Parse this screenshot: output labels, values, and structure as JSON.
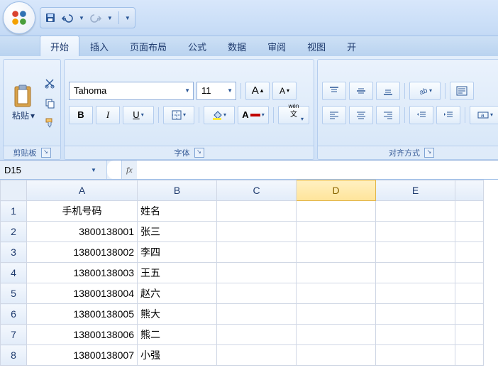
{
  "qat": {
    "save": "save",
    "undo": "undo",
    "redo": "redo"
  },
  "tabs": {
    "items": [
      "开始",
      "插入",
      "页面布局",
      "公式",
      "数据",
      "审阅",
      "视图",
      "开"
    ],
    "active_index": 0
  },
  "ribbon": {
    "clipboard": {
      "paste_label": "粘贴",
      "group_label": "剪贴板"
    },
    "font": {
      "name": "Tahoma",
      "size": "11",
      "increase": "A",
      "decrease": "A",
      "bold": "B",
      "italic": "I",
      "underline": "U",
      "wen": "wén 文",
      "group_label": "字体"
    },
    "align": {
      "group_label": "对齐方式"
    }
  },
  "formula_bar": {
    "cell_ref": "D15",
    "fx_label": "fx",
    "value": ""
  },
  "sheet": {
    "columns": [
      "A",
      "B",
      "C",
      "D",
      "E",
      ""
    ],
    "selected_col": "D",
    "rows": [
      {
        "n": "1",
        "A": "手机号码",
        "B": "姓名",
        "A_align": "txt"
      },
      {
        "n": "2",
        "A": "3800138001",
        "B": "张三",
        "A_align": "num"
      },
      {
        "n": "3",
        "A": "13800138002",
        "B": "李四",
        "A_align": "num"
      },
      {
        "n": "4",
        "A": "13800138003",
        "B": "王五",
        "A_align": "num"
      },
      {
        "n": "5",
        "A": "13800138004",
        "B": "赵六",
        "A_align": "num"
      },
      {
        "n": "6",
        "A": "13800138005",
        "B": "熊大",
        "A_align": "num"
      },
      {
        "n": "7",
        "A": "13800138006",
        "B": "熊二",
        "A_align": "num"
      },
      {
        "n": "8",
        "A": "13800138007",
        "B": "小强",
        "A_align": "num"
      }
    ]
  }
}
